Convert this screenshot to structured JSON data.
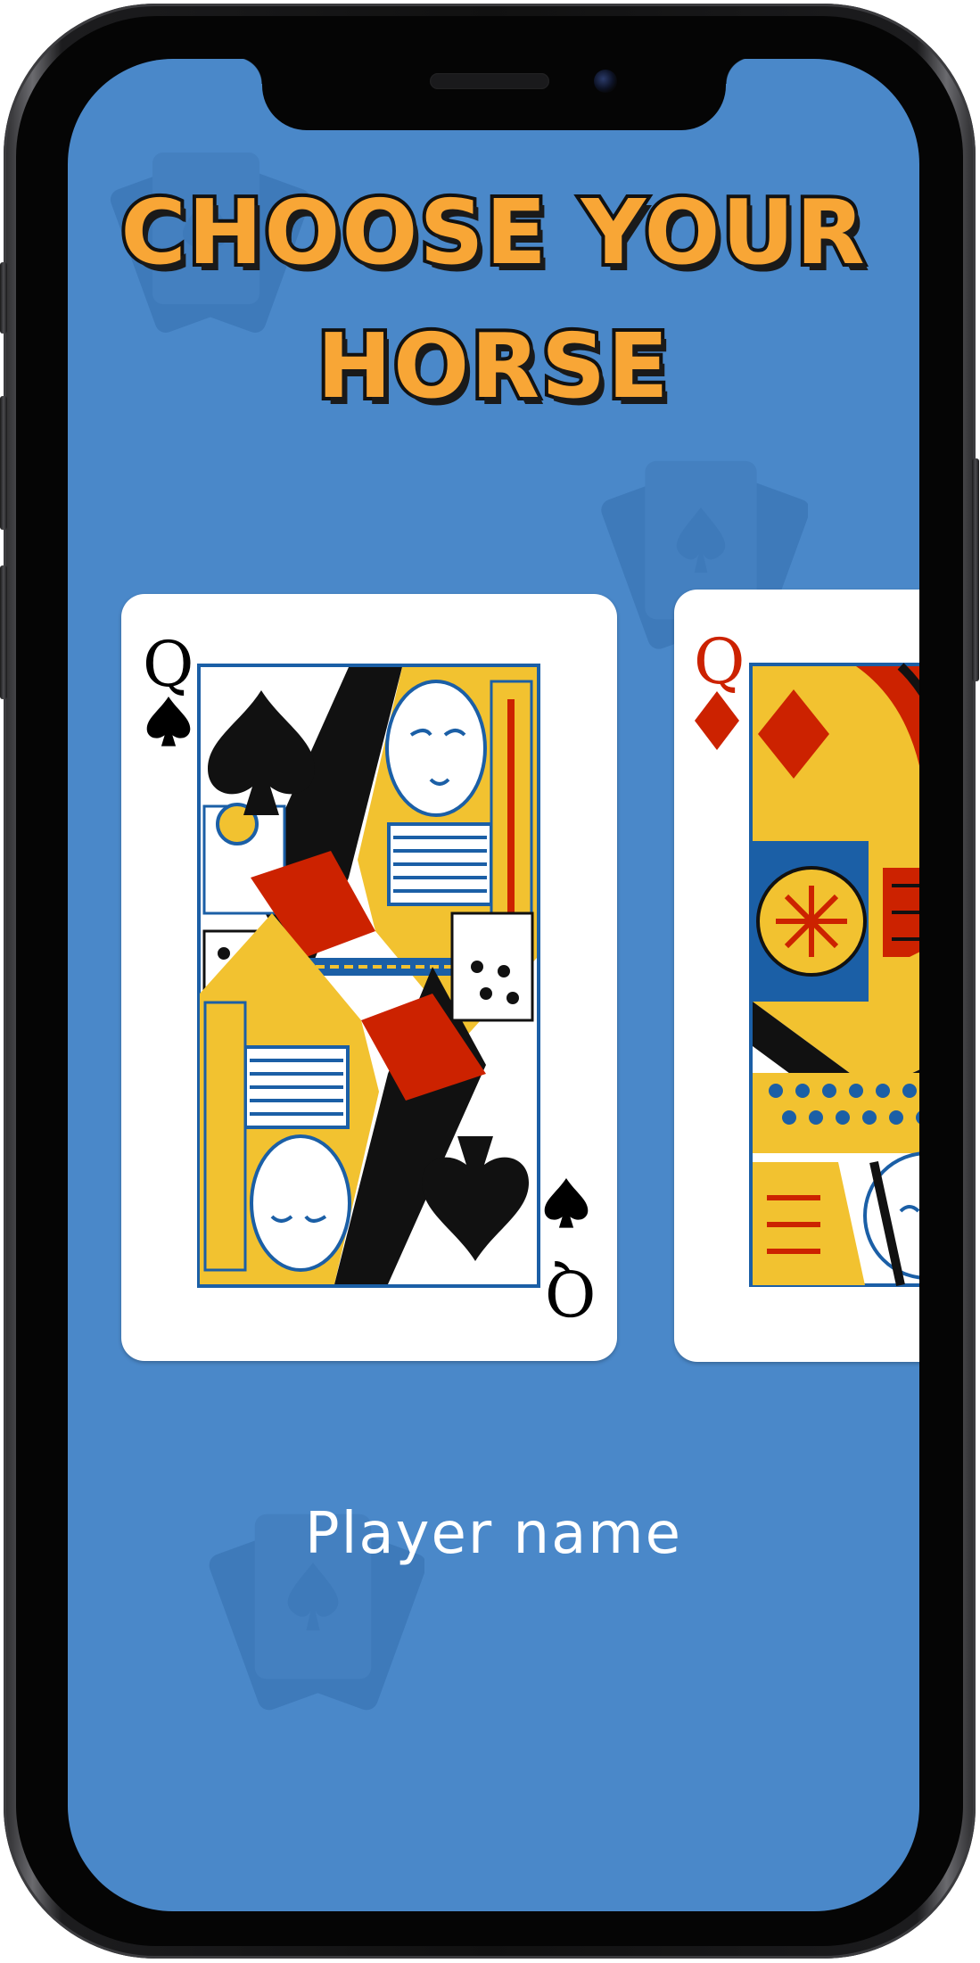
{
  "title": {
    "line1": "CHOOSE YOUR",
    "line2": "HORSE"
  },
  "cards": [
    {
      "rank": "Q",
      "suit": "spade-icon",
      "color": "#000000"
    },
    {
      "rank": "Q",
      "suit": "diamond-icon",
      "color": "#cc2200"
    }
  ],
  "player": {
    "name_label": "Player name"
  },
  "colors": {
    "background": "#4a88c9",
    "title_fill": "#f8a636",
    "card_red": "#cc2200",
    "card_blue": "#1b5fa6",
    "card_gold": "#f2c230"
  }
}
